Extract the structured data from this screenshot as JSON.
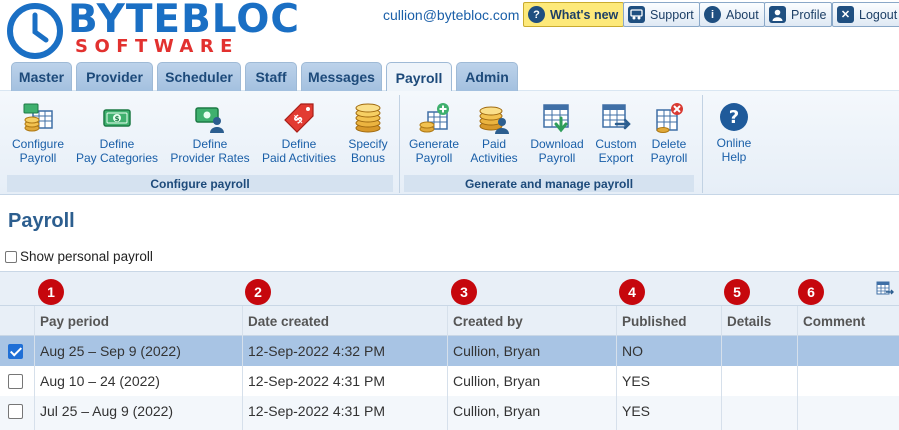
{
  "brand": {
    "line1": "BYTEBLOC",
    "line2": "SOFTWARE",
    "colors": {
      "blue": "#1a6fc4",
      "red": "#e2312f"
    }
  },
  "header": {
    "email": "cullion@bytebloc.com",
    "buttons": [
      {
        "label": "What's new",
        "icon": "question-icon"
      },
      {
        "label": "Support",
        "icon": "support-icon"
      },
      {
        "label": "About",
        "icon": "info-icon"
      },
      {
        "label": "Profile",
        "icon": "user-icon"
      },
      {
        "label": "Logout",
        "icon": "close-icon"
      }
    ]
  },
  "tabs": [
    "Master",
    "Provider",
    "Scheduler",
    "Staff",
    "Messages",
    "Payroll",
    "Admin"
  ],
  "active_tab": "Payroll",
  "ribbon": {
    "configure": [
      {
        "line1": "Configure",
        "line2": "Payroll",
        "icon": "configure-payroll-icon"
      },
      {
        "line1": "Define",
        "line2": "Pay Categories",
        "icon": "pay-categories-icon"
      },
      {
        "line1": "Define",
        "line2": "Provider Rates",
        "icon": "provider-rates-icon"
      },
      {
        "line1": "Define",
        "line2": "Paid Activities",
        "icon": "price-tag-icon"
      },
      {
        "line1": "Specify",
        "line2": "Bonus",
        "icon": "coins-icon"
      }
    ],
    "generate": [
      {
        "line1": "Generate",
        "line2": "Payroll",
        "icon": "generate-payroll-icon"
      },
      {
        "line1": "Paid",
        "line2": "Activities",
        "icon": "paid-activities-icon"
      },
      {
        "line1": "Download",
        "line2": "Payroll",
        "icon": "download-icon"
      },
      {
        "line1": "Custom",
        "line2": "Export",
        "icon": "export-icon"
      },
      {
        "line1": "Delete",
        "line2": "Payroll",
        "icon": "delete-icon"
      }
    ],
    "help": {
      "line1": "Online",
      "line2": "Help",
      "icon": "help-icon"
    },
    "group_labels": {
      "configure": "Configure payroll",
      "generate": "Generate and manage payroll"
    }
  },
  "page": {
    "title": "Payroll",
    "show_personal_label": "Show personal payroll",
    "show_personal_checked": false
  },
  "grid": {
    "markers": [
      "1",
      "2",
      "3",
      "4",
      "5",
      "6"
    ],
    "columns": [
      "Pay period",
      "Date created",
      "Created by",
      "Published",
      "Details",
      "Comment"
    ],
    "rows": [
      {
        "selected": true,
        "pay_period": "Aug 25 – Sep 9 (2022)",
        "date_created": "12-Sep-2022 4:32 PM",
        "created_by": "Cullion, Bryan",
        "published": "NO",
        "details": "",
        "comment": ""
      },
      {
        "selected": false,
        "pay_period": "Aug 10 – 24 (2022)",
        "date_created": "12-Sep-2022 4:31 PM",
        "created_by": "Cullion, Bryan",
        "published": "YES",
        "details": "",
        "comment": ""
      },
      {
        "selected": false,
        "pay_period": "Jul 25 – Aug 9 (2022)",
        "date_created": "12-Sep-2022 4:31 PM",
        "created_by": "Cullion, Bryan",
        "published": "YES",
        "details": "",
        "comment": ""
      }
    ]
  }
}
